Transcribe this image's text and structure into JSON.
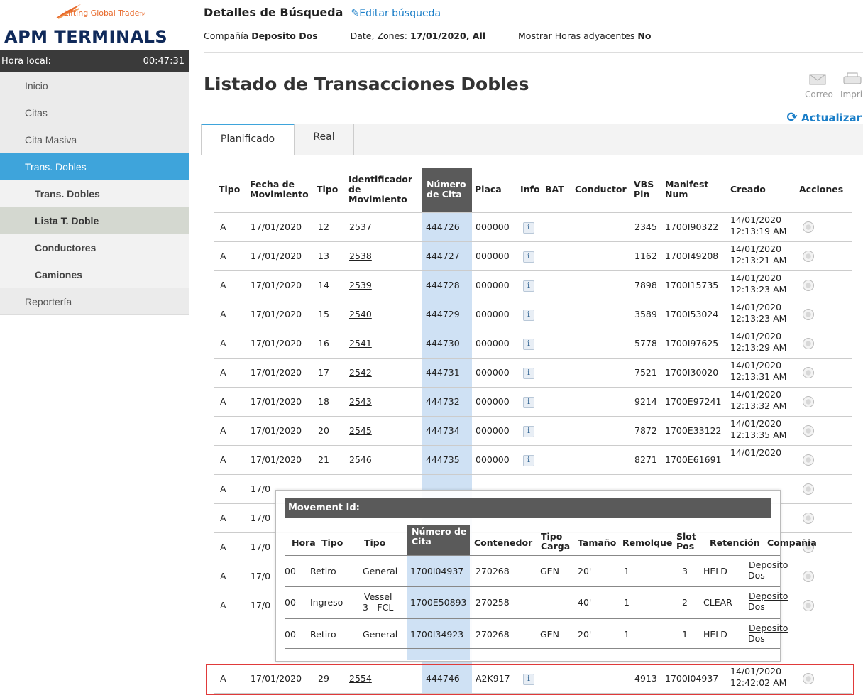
{
  "logo": {
    "tagline": "Lifting Global Trade",
    "tm": "TM",
    "brand": "APM TERMINALS"
  },
  "clock": {
    "label": "Hora local:",
    "time": "00:47:31"
  },
  "nav": [
    {
      "label": "Inicio"
    },
    {
      "label": "Citas"
    },
    {
      "label": "Cita Masiva"
    },
    {
      "label": "Trans. Dobles"
    },
    {
      "label": "Trans. Dobles"
    },
    {
      "label": "Lista T. Doble"
    },
    {
      "label": "Conductores"
    },
    {
      "label": "Camiones"
    },
    {
      "label": "Reportería"
    }
  ],
  "search": {
    "title": "Detalles de Búsqueda",
    "edit": "Editar búsqueda",
    "company_label": "Compañía",
    "company": "Deposito Dos",
    "date_label": "Date, Zones:",
    "date": "17/01/2020, All",
    "adj_label": "Mostrar Horas adyacentes",
    "adj": "No"
  },
  "page_title": "Listado de Transacciones Dobles",
  "tools": {
    "email": "Correo",
    "print": "Impri",
    "refresh": "Actualizar"
  },
  "tabs": [
    "Planificado",
    "Real"
  ],
  "table": {
    "headers": {
      "tipo": "Tipo",
      "fecha1": "Fecha de",
      "fecha2": "Movimiento",
      "tipo2": "Tipo",
      "ident1": "Identificador",
      "ident2": "de",
      "ident3": "Movimiento",
      "num1": "Número",
      "num2": "de Cita",
      "placa": "Placa",
      "info": "Info",
      "bat": "BAT",
      "conductor": "Conductor",
      "vbs1": "VBS",
      "vbs2": "Pin",
      "man1": "Manifest",
      "man2": "Num",
      "creado": "Creado",
      "acciones": "Acciones"
    },
    "rows": [
      {
        "tipo": "A",
        "fecha": "17/01/2020",
        "tipo2": "12",
        "ident": "2537",
        "num": "444726",
        "placa": "000000",
        "vbs": "2345",
        "manifest": "1700I90322",
        "creado1": "14/01/2020",
        "creado2": "12:13:19 AM"
      },
      {
        "tipo": "A",
        "fecha": "17/01/2020",
        "tipo2": "13",
        "ident": "2538",
        "num": "444727",
        "placa": "000000",
        "vbs": "1162",
        "manifest": "1700I49208",
        "creado1": "14/01/2020",
        "creado2": "12:13:21 AM"
      },
      {
        "tipo": "A",
        "fecha": "17/01/2020",
        "tipo2": "14",
        "ident": "2539",
        "num": "444728",
        "placa": "000000",
        "vbs": "7898",
        "manifest": "1700I15735",
        "creado1": "14/01/2020",
        "creado2": "12:13:23 AM"
      },
      {
        "tipo": "A",
        "fecha": "17/01/2020",
        "tipo2": "15",
        "ident": "2540",
        "num": "444729",
        "placa": "000000",
        "vbs": "3589",
        "manifest": "1700I53024",
        "creado1": "14/01/2020",
        "creado2": "12:13:23 AM"
      },
      {
        "tipo": "A",
        "fecha": "17/01/2020",
        "tipo2": "16",
        "ident": "2541",
        "num": "444730",
        "placa": "000000",
        "vbs": "5778",
        "manifest": "1700I97625",
        "creado1": "14/01/2020",
        "creado2": "12:13:29 AM"
      },
      {
        "tipo": "A",
        "fecha": "17/01/2020",
        "tipo2": "17",
        "ident": "2542",
        "num": "444731",
        "placa": "000000",
        "vbs": "7521",
        "manifest": "1700I30020",
        "creado1": "14/01/2020",
        "creado2": "12:13:31 AM"
      },
      {
        "tipo": "A",
        "fecha": "17/01/2020",
        "tipo2": "18",
        "ident": "2543",
        "num": "444732",
        "placa": "000000",
        "vbs": "9214",
        "manifest": "1700E97241",
        "creado1": "14/01/2020",
        "creado2": "12:13:32 AM"
      },
      {
        "tipo": "A",
        "fecha": "17/01/2020",
        "tipo2": "20",
        "ident": "2545",
        "num": "444734",
        "placa": "000000",
        "vbs": "7872",
        "manifest": "1700E33122",
        "creado1": "14/01/2020",
        "creado2": "12:13:35 AM"
      },
      {
        "tipo": "A",
        "fecha": "17/01/2020",
        "tipo2": "21",
        "ident": "2546",
        "num": "444735",
        "placa": "000000",
        "vbs": "8271",
        "manifest": "1700E61691",
        "creado1": "14/01/2020",
        "creado2": ""
      },
      {
        "tipo": "A",
        "fecha": "17/0",
        "tipo2": "",
        "ident": "",
        "num": "",
        "placa": "",
        "vbs": "",
        "manifest": "",
        "creado1": "",
        "creado2": ""
      },
      {
        "tipo": "A",
        "fecha": "17/0",
        "tipo2": "",
        "ident": "",
        "num": "",
        "placa": "",
        "vbs": "",
        "manifest": "",
        "creado1": "",
        "creado2": ""
      },
      {
        "tipo": "A",
        "fecha": "17/0",
        "tipo2": "",
        "ident": "",
        "num": "",
        "placa": "",
        "vbs": "",
        "manifest": "",
        "creado1": "",
        "creado2": ""
      },
      {
        "tipo": "A",
        "fecha": "17/0",
        "tipo2": "",
        "ident": "",
        "num": "",
        "placa": "",
        "vbs": "",
        "manifest": "",
        "creado1": "",
        "creado2": ""
      },
      {
        "tipo": "A",
        "fecha": "17/0",
        "tipo2": "",
        "ident": "",
        "num": "",
        "placa": "",
        "vbs": "",
        "manifest": "",
        "creado1": "",
        "creado2": ""
      },
      {
        "tipo": "A",
        "fecha": "17/01/2020",
        "tipo2": "29",
        "ident": "2554",
        "num": "444746",
        "placa": "A2K917",
        "vbs": "4913",
        "manifest": "1700I04937",
        "creado1": "14/01/2020",
        "creado2": "12:42:02 AM"
      }
    ]
  },
  "popup": {
    "title": "Movement Id:",
    "headers": {
      "hora": "Hora",
      "tipo": "Tipo",
      "tipo2": "Tipo",
      "num1": "Número de",
      "num2": "Cita",
      "contenedor": "Contenedor",
      "carga1": "Tipo",
      "carga2": "Carga",
      "tamano": "Tamaño",
      "remolque": "Remolque",
      "slot1": "Slot",
      "slot2": "Pos",
      "retencion": "Retención",
      "compania": "Compañia"
    },
    "rows": [
      {
        "hora": "00",
        "tipo": "Retiro",
        "tipo2a": "General",
        "tipo2b": "",
        "num": "1700I04937",
        "cont": "270268",
        "carga": "GEN",
        "tam": "20'",
        "rem": "1",
        "slot": "3",
        "ret": "HELD",
        "comp1": "Deposito",
        "comp2": "Dos"
      },
      {
        "hora": "00",
        "tipo": "Ingreso",
        "tipo2a": "Vessel",
        "tipo2b": "3 - FCL",
        "num": "1700E50893",
        "cont": "270258",
        "carga": "",
        "tam": "40'",
        "rem": "1",
        "slot": "2",
        "ret": "CLEAR",
        "comp1": "Deposito",
        "comp2": "Dos"
      },
      {
        "hora": "00",
        "tipo": "Retiro",
        "tipo2a": "General",
        "tipo2b": "",
        "num": "1700I34923",
        "cont": "270268",
        "carga": "GEN",
        "tam": "20'",
        "rem": "1",
        "slot": "1",
        "ret": "HELD",
        "comp1": "Deposito",
        "comp2": "Dos"
      }
    ]
  }
}
